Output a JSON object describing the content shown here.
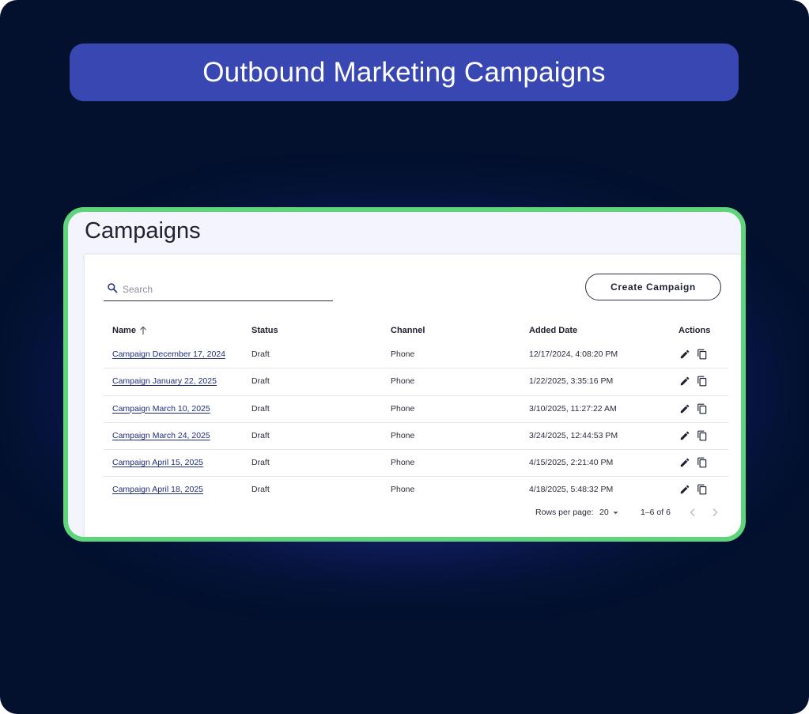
{
  "banner": {
    "title": "Outbound Marketing Campaigns"
  },
  "page": {
    "title": "Campaigns"
  },
  "search": {
    "placeholder": "Search",
    "value": ""
  },
  "toolbar": {
    "create_label": "Create Campaign"
  },
  "table": {
    "columns": {
      "name": "Name",
      "status": "Status",
      "channel": "Channel",
      "added_date": "Added Date",
      "actions": "Actions"
    },
    "sort": {
      "column": "Name",
      "direction": "ascending"
    },
    "rows": [
      {
        "name": "Campaign December 17, 2024",
        "status": "Draft",
        "channel": "Phone",
        "added_date": "12/17/2024, 4:08:20 PM"
      },
      {
        "name": "Campaign January 22, 2025",
        "status": "Draft",
        "channel": "Phone",
        "added_date": "1/22/2025, 3:35:16 PM"
      },
      {
        "name": "Campaign March 10, 2025",
        "status": "Draft",
        "channel": "Phone",
        "added_date": "3/10/2025, 11:27:22 AM"
      },
      {
        "name": "Campaign March 24, 2025",
        "status": "Draft",
        "channel": "Phone",
        "added_date": "3/24/2025, 12:44:53 PM"
      },
      {
        "name": "Campaign April 15, 2025",
        "status": "Draft",
        "channel": "Phone",
        "added_date": "4/15/2025, 2:21:40 PM"
      },
      {
        "name": "Campaign April 18, 2025",
        "status": "Draft",
        "channel": "Phone",
        "added_date": "4/18/2025, 5:48:32 PM"
      }
    ]
  },
  "pagination": {
    "rows_per_page_label": "Rows per page:",
    "rows_per_page": "20",
    "range": "1–6 of 6"
  },
  "icons": {
    "search": "search-icon",
    "sort": "arrow-up-icon",
    "edit": "pencil-icon",
    "copy": "copy-icon",
    "dropdown": "caret-down-icon",
    "prev": "chevron-left-icon",
    "next": "chevron-right-icon"
  },
  "colors": {
    "background": "#03112f",
    "banner": "#3947b3",
    "card_border": "#5fd47b",
    "card_bg": "#f4f4fd",
    "link": "#1f2e7a"
  }
}
